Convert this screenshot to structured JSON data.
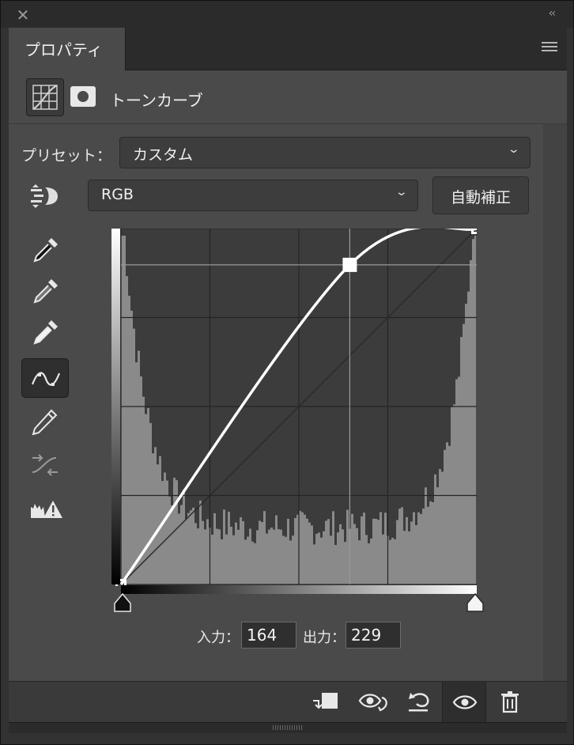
{
  "titlebar": {
    "close_glyph": "✕",
    "collapse_glyph": "‹‹"
  },
  "panel": {
    "tab_label": "プロパティ"
  },
  "header": {
    "title": "トーンカーブ"
  },
  "preset": {
    "label": "プリセット：",
    "value": "カスタム"
  },
  "channel": {
    "value": "RGB"
  },
  "auto_button": {
    "label": "自動補正"
  },
  "tools": [
    {
      "name": "sample-shadow-eyedropper-icon"
    },
    {
      "name": "sample-midtone-eyedropper-icon"
    },
    {
      "name": "sample-highlight-eyedropper-icon"
    },
    {
      "name": "curve-points-tool-icon",
      "active": true
    },
    {
      "name": "pencil-draw-icon"
    },
    {
      "name": "smooth-curve-icon",
      "disabled": true
    },
    {
      "name": "clipping-warning-icon"
    }
  ],
  "io": {
    "input_label": "入力：",
    "input_value": "164",
    "output_label": "出力：",
    "output_value": "229"
  },
  "curve": {
    "range": [
      0,
      255
    ],
    "points": [
      [
        0,
        0
      ],
      [
        164,
        229
      ],
      [
        255,
        255
      ]
    ],
    "curve_color": "#ffffff"
  },
  "footer_icons": [
    "clip-to-layer-icon",
    "view-previous-state-icon",
    "reset-icon",
    "visibility-eye-icon",
    "trash-icon"
  ],
  "colors": {
    "panel_bg": "#4a4a4a",
    "dark_bg": "#323232",
    "histogram": "#8a8a8a"
  }
}
